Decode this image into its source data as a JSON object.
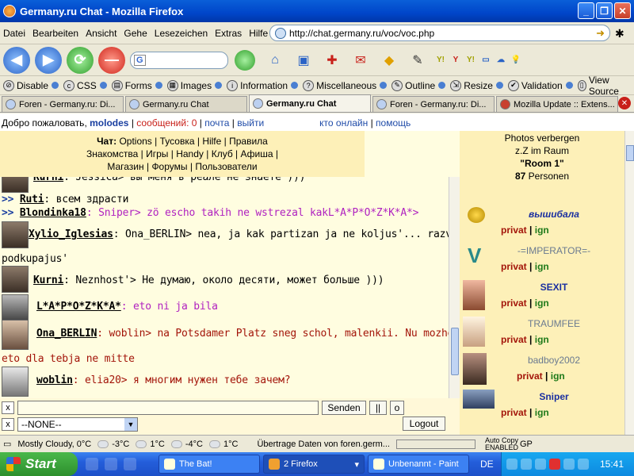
{
  "window": {
    "title": "Germany.ru Chat - Mozilla Firefox"
  },
  "menu": [
    "Datei",
    "Bearbeiten",
    "Ansicht",
    "Gehe",
    "Lesezeichen",
    "Extras",
    "Hilfe"
  ],
  "address": {
    "url": "http://chat.germany.ru/voc/voc.php"
  },
  "search": {
    "value": "G"
  },
  "devbar": [
    "Disable",
    "CSS",
    "Forms",
    "Images",
    "Information",
    "Miscellaneous",
    "Outline",
    "Resize",
    "Validation",
    "View Source"
  ],
  "tabs": [
    {
      "label": "Foren - Germany.ru: Di..."
    },
    {
      "label": "Germany.ru Chat"
    },
    {
      "label": "Germany.ru Chat",
      "active": true
    },
    {
      "label": "Foren - Germany.ru: Di..."
    },
    {
      "label": "Mozilla Update :: Extens..."
    }
  ],
  "userline": {
    "greeting": "Добро пожаловать,",
    "nick": "molodes",
    "messages": "сообщений: 0",
    "mail": "почта",
    "logout": "выйти",
    "online": "кто онлайн",
    "help": "помощь",
    "sep": "|"
  },
  "chatmenu": {
    "label": "Чат:",
    "line1": [
      "Options",
      "Тусовка",
      "Hilfe",
      "Правила"
    ],
    "line2": [
      "Знакомства",
      "Игры",
      "Handy",
      "Клуб",
      "Афиша"
    ],
    "line3": [
      "Магазин",
      "Форумы",
      "Пользователи"
    ]
  },
  "messages": [
    {
      "nick": "Kurni",
      "text": ": Jessica> вы меня в реале не знаете )))",
      "color": "#000000"
    },
    {
      "prefix": ">>",
      "nick": "Ruti",
      "text": ": всем здрасти",
      "color": "#000000"
    },
    {
      "prefix": ">>",
      "nick": "Blondinka18",
      "text": ": Sniper> zö escho takih ne wstrezal kakL*A*P*O*Z*K*A*>",
      "color": "#b022c0"
    },
    {
      "nick": "Xylio_Iglesias",
      "text": ": Ona_BERLIN> nea, ja kak partizan ja ne koljus'... razve chto",
      "text2": "podkupajus'",
      "color": "#000000"
    },
    {
      "nick": "Kurni",
      "text": ": Neznhost'> Не думаю, около десяти, может больше )))",
      "color": "#000000"
    },
    {
      "nick": "L*A*P*O*Z*K*A*",
      "text": ": eto ni ja bila",
      "color": "#b022c0"
    },
    {
      "nick": "Ona_BERLIN",
      "text": ": woblin> na Potsdamer Platz sneg schol, malenkii. Nu mozhet",
      "text2": "eto dla tebja ne mitte",
      "color": "#a3150a"
    },
    {
      "nick": "woblin",
      "text": ": elia20> я многим нужен    тебе зачем?",
      "color": "#a3150a"
    }
  ],
  "sidebar": {
    "hide_photos": "Photos verbergen",
    "zz": "z.Z im Raum",
    "room": "\"Room 1\"",
    "count": "87",
    "count_label": "Personen",
    "privat": "privat",
    "ign": "ign",
    "sep": "|",
    "users": [
      {
        "name": "вышибала",
        "color": "#1a2fa0",
        "style": "bold-italic"
      },
      {
        "name": "-=IMPERATOR=-",
        "color": "#6a7a90",
        "style": "normal"
      },
      {
        "name": "SEXIT",
        "color": "#1a2fa0",
        "style": "bold"
      },
      {
        "name": "TRAUMFEE",
        "color": "#6a7a90",
        "style": "normal"
      },
      {
        "name": "badboy2002",
        "color": "#6a7a90",
        "style": "normal"
      },
      {
        "name": "Sniper",
        "color": "#1a2fa0",
        "style": "bold"
      }
    ]
  },
  "input": {
    "x": "x",
    "send": "Senden",
    "pause": "||",
    "o": "o",
    "select": "--NONE--",
    "logout": "Logout"
  },
  "status": {
    "weather": "Mostly Cloudy, 0°C",
    "temps": [
      "-3°C",
      "1°C",
      "-4°C",
      "1°C"
    ],
    "transfer": "Übertrage Daten von foren.germ...",
    "autocopy": "Auto Copy",
    "enabled": "ENABLED",
    "gp": "GP"
  },
  "taskbar": {
    "start": "Start",
    "tasks": [
      "The Bat!",
      "2 Firefox",
      "Unbenannt - Paint"
    ],
    "lang": "DE",
    "time": "15:41"
  }
}
